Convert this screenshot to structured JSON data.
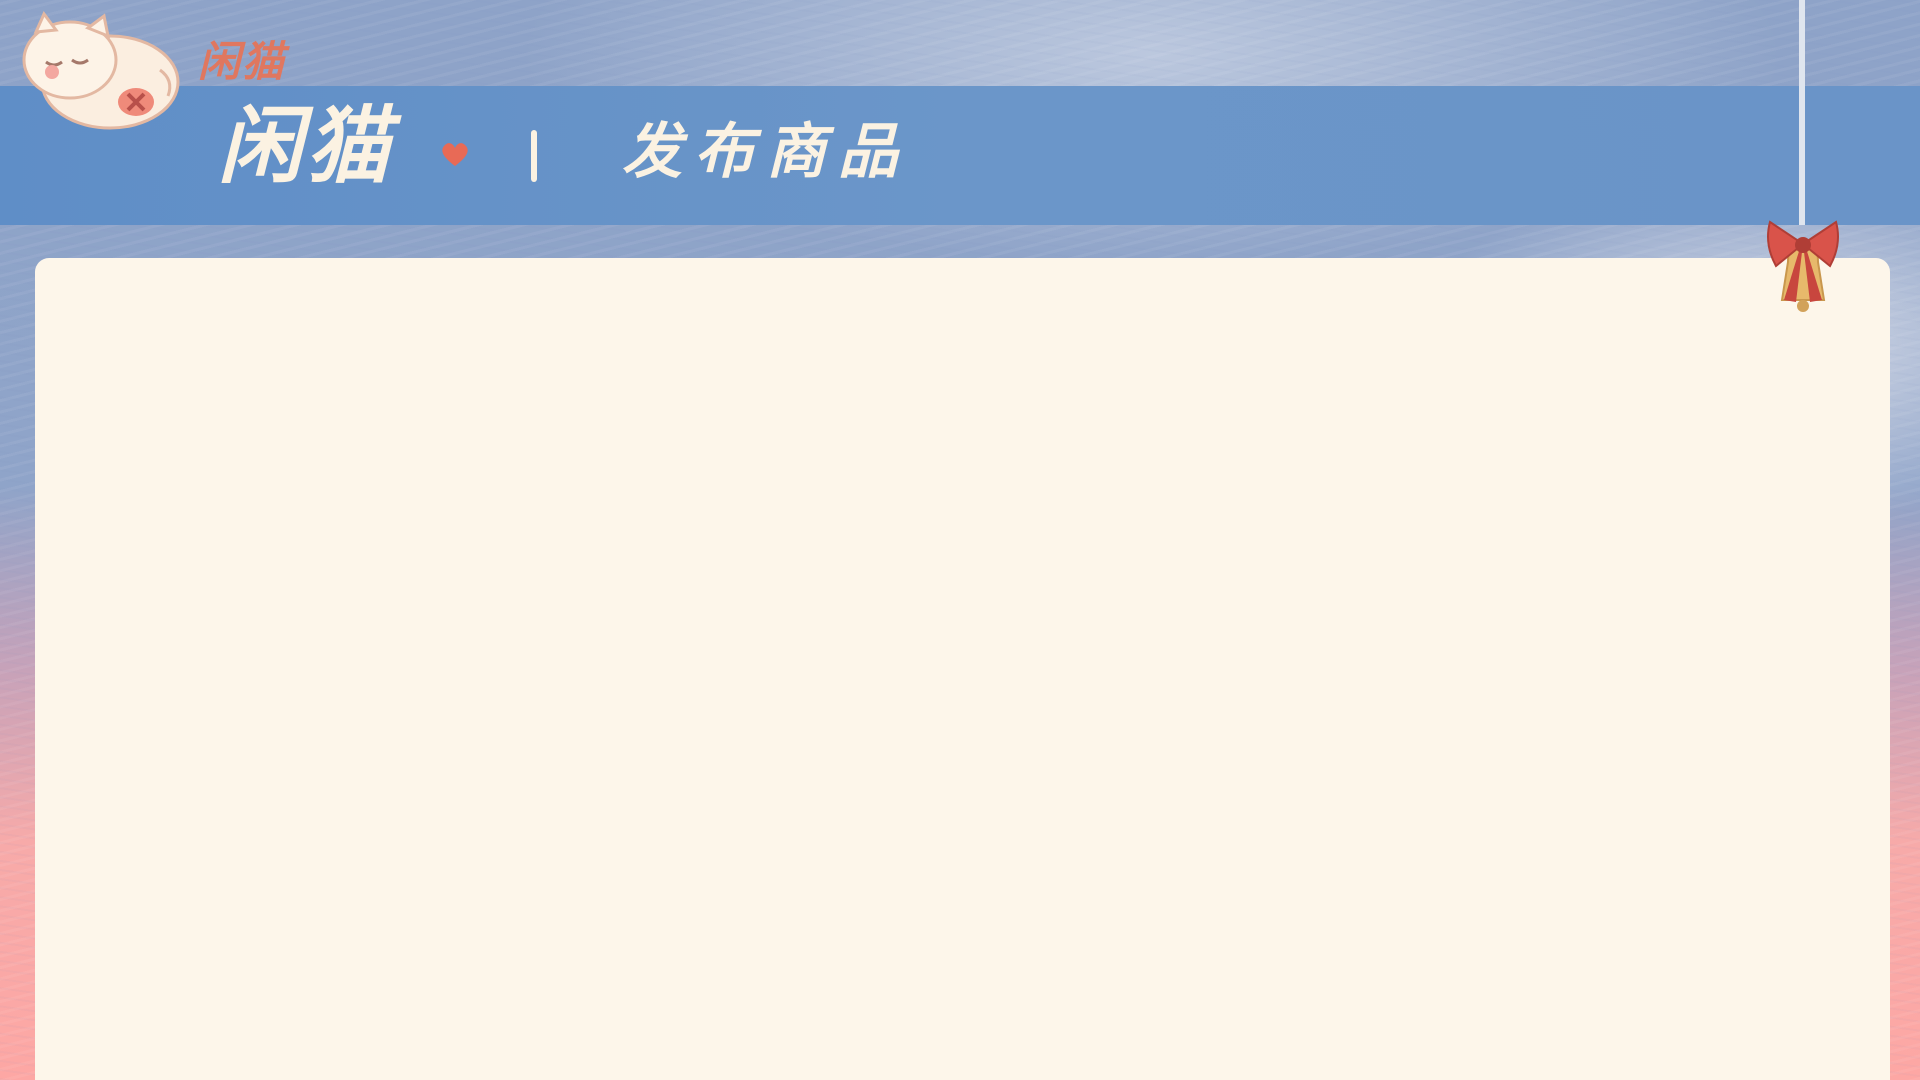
{
  "header": {
    "small_logo": "闲猫",
    "brand": "闲猫",
    "separator": "|",
    "page_title": "发布商品"
  },
  "icons": {
    "mascot": "sleeping-cat-icon",
    "heart": "heart-icon",
    "bell": "christmas-bell-icon"
  },
  "colors": {
    "header_band": "#6b96c9",
    "panel": "#fdf6ea",
    "brand_text": "#fbf2e2",
    "accent": "#e0775f",
    "bow": "#d9534a"
  }
}
